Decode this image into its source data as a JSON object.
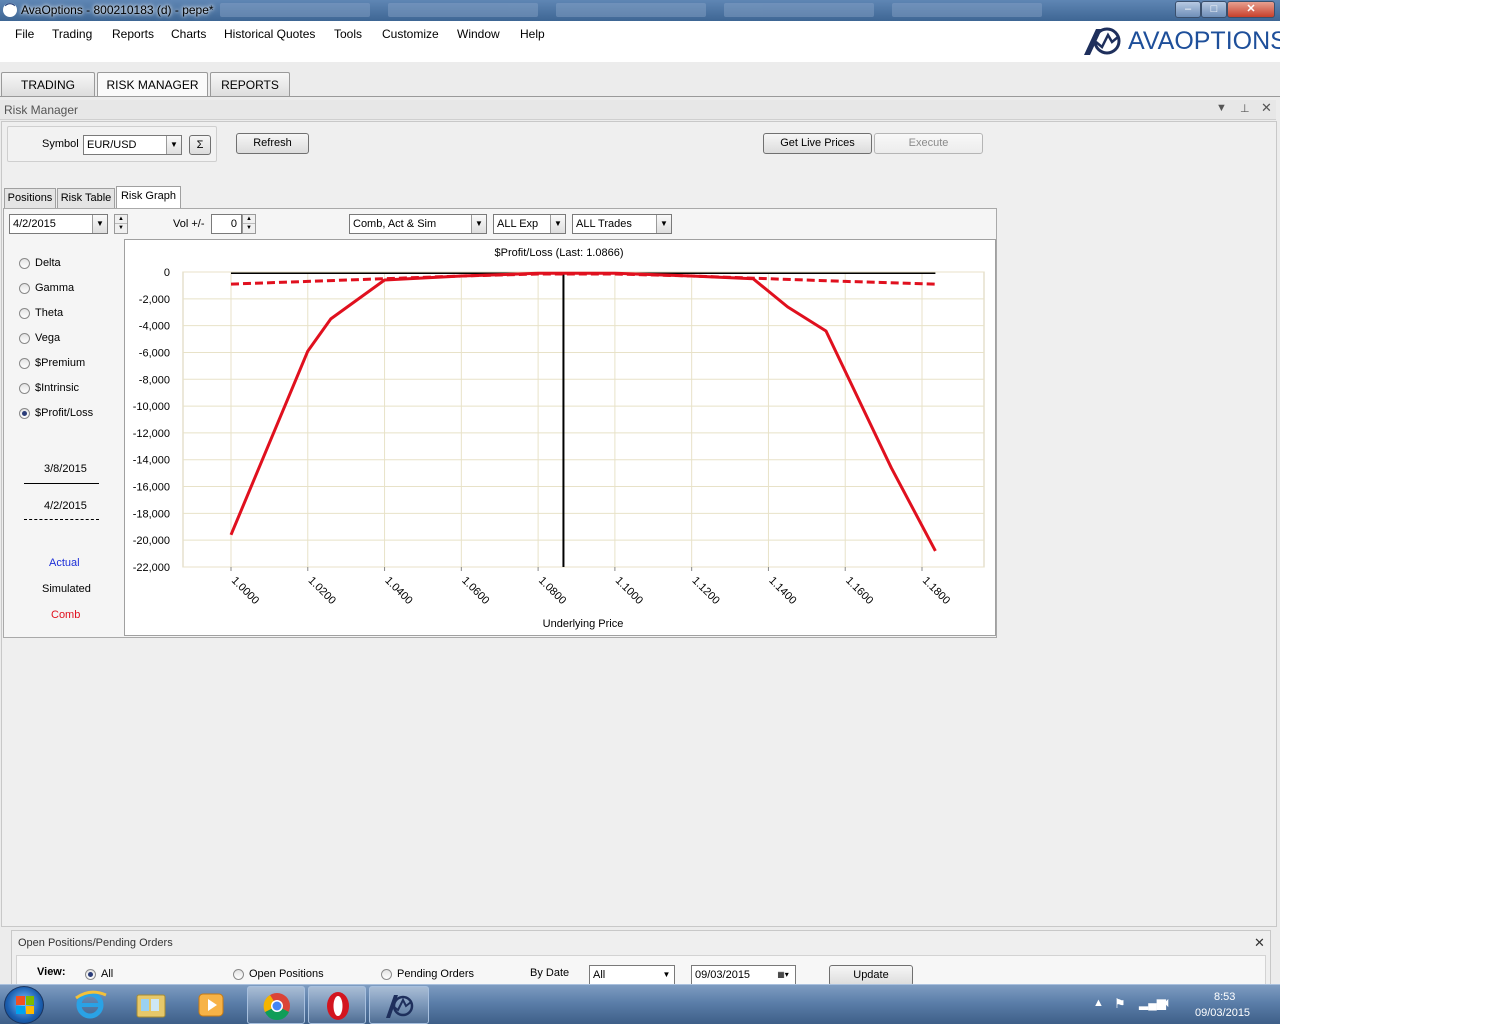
{
  "window": {
    "title": "AvaOptions - 800210183 (d) - pepe*",
    "controls": {
      "minimize": "‒",
      "maximize": "□",
      "close": "✕"
    }
  },
  "menu": [
    "File",
    "Trading",
    "Reports",
    "Charts",
    "Historical Quotes",
    "Tools",
    "Customize",
    "Window",
    "Help"
  ],
  "logo": {
    "text": "AVAOPTIONS",
    "brand_color": "#1e4f9a"
  },
  "main_tabs": [
    "TRADING",
    "RISK MANAGER",
    "REPORTS"
  ],
  "risk_manager": {
    "title": "Risk Manager",
    "symbol_label": "Symbol",
    "symbol_value": "EUR/USD",
    "sigma_label": "Σ",
    "refresh_label": "Refresh",
    "get_live_prices_label": "Get Live Prices",
    "execute_label": "Execute",
    "sub_tabs": [
      "Positions",
      "Risk Table",
      "Risk Graph"
    ],
    "active_sub_tab": "Risk Graph",
    "date_value": "4/2/2015",
    "vol_label": "Vol +/-",
    "vol_value": "0",
    "mode_value": "Comb, Act & Sim",
    "exp_value": "ALL Exp",
    "trades_value": "ALL Trades",
    "greeks": [
      "Delta",
      "Gamma",
      "Theta",
      "Vega",
      "$Premium",
      "$Intrinsic",
      "$Profit/Loss"
    ],
    "selected_greek": "$Profit/Loss",
    "legend_dates": {
      "actual_date": "3/8/2015",
      "simulated_date": "4/2/2015"
    },
    "legend_labels": {
      "actual": "Actual",
      "simulated": "Simulated",
      "comb": "Comb"
    },
    "colors": {
      "actual": "#1c2ed8",
      "simulated": "#000000",
      "comb": "#e0101e",
      "grid": "#e8e2c8"
    }
  },
  "chart_data": {
    "type": "line",
    "title": "$Profit/Loss (Last: 1.0866)",
    "xlabel": "Underlying Price",
    "ylabel": "",
    "xlim": [
      1.0,
      1.18
    ],
    "ylim": [
      -22000,
      0
    ],
    "x_ticks": [
      "1.0000",
      "1.0200",
      "1.0400",
      "1.0600",
      "1.0800",
      "1.1000",
      "1.1200",
      "1.1400",
      "1.1600",
      "1.1800"
    ],
    "x_tick_values": [
      1.0,
      1.02,
      1.04,
      1.06,
      1.08,
      1.1,
      1.12,
      1.14,
      1.16,
      1.18
    ],
    "y_ticks": [
      "0",
      "-2,000",
      "-4,000",
      "-6,000",
      "-8,000",
      "-10,000",
      "-12,000",
      "-14,000",
      "-16,000",
      "-18,000",
      "-20,000",
      "-22,000"
    ],
    "y_tick_values": [
      0,
      -2000,
      -4000,
      -6000,
      -8000,
      -10000,
      -12000,
      -14000,
      -16000,
      -18000,
      -20000,
      -22000
    ],
    "last_price": 1.0866,
    "grid": true,
    "series": [
      {
        "style": "solid",
        "color": "#e0101e",
        "x": [
          1.0,
          1.02,
          1.026,
          1.04,
          1.06,
          1.08,
          1.1,
          1.12,
          1.136,
          1.145,
          1.155,
          1.172,
          1.1835
        ],
        "y": [
          -19600,
          -5900,
          -3500,
          -600,
          -300,
          -100,
          -100,
          -300,
          -500,
          -2600,
          -4400,
          -14600,
          -20800
        ]
      },
      {
        "style": "dashed",
        "color": "#e0101e",
        "x": [
          1.0,
          1.02,
          1.04,
          1.06,
          1.08,
          1.1,
          1.12,
          1.14,
          1.16,
          1.1835
        ],
        "y": [
          -900,
          -700,
          -500,
          -300,
          -150,
          -150,
          -300,
          -500,
          -700,
          -900
        ]
      },
      {
        "style": "solid",
        "color": "#000000",
        "x": [
          1.0,
          1.1835
        ],
        "y": [
          -100,
          -100
        ]
      }
    ]
  },
  "bottom_panel": {
    "title": "Open Positions/Pending Orders",
    "view_label": "View:",
    "view_options": [
      "All",
      "Open Positions",
      "Pending Orders"
    ],
    "selected_view": "All",
    "by_date_label": "By Date",
    "by_date_value": "All",
    "date_value": "09/03/2015",
    "update_label": "Update"
  },
  "taskbar": {
    "time": "8:53",
    "date": "09/03/2015"
  }
}
